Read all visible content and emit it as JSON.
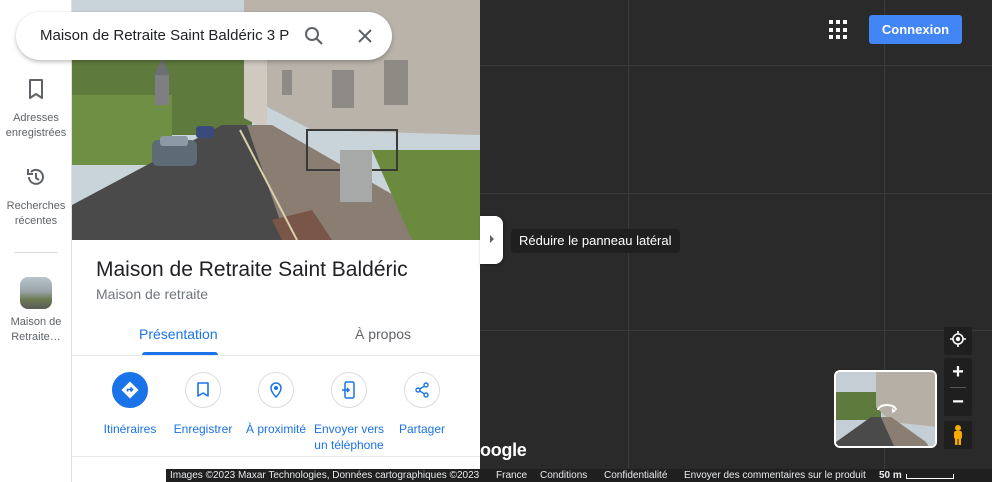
{
  "search": {
    "query": "Maison de Retraite Saint Baldéric 3 P",
    "search_icon": "search-icon",
    "close_icon": "close-icon"
  },
  "rail": {
    "saved": {
      "label": "Adresses enregistrées",
      "icon": "bookmark-icon"
    },
    "recent": {
      "label": "Recherches récentes",
      "icon": "history-icon"
    },
    "place": {
      "label": "Maison de Retraite…"
    }
  },
  "place": {
    "name": "Maison de Retraite Saint Baldéric",
    "category": "Maison de retraite"
  },
  "tabs": [
    {
      "label": "Présentation",
      "active": true
    },
    {
      "label": "À propos",
      "active": false
    }
  ],
  "actions": [
    {
      "label": "Itinéraires",
      "icon": "directions-icon"
    },
    {
      "label": "Enregistrer",
      "icon": "bookmark-icon"
    },
    {
      "label": "À proximité",
      "icon": "nearby-icon"
    },
    {
      "label": "Envoyer vers un téléphone",
      "icon": "send-to-phone-icon"
    },
    {
      "label": "Partager",
      "icon": "share-icon"
    }
  ],
  "collapse": {
    "tooltip": "Réduire le panneau latéral"
  },
  "header": {
    "signin_label": "Connexion",
    "apps_icon": "apps-grid-icon"
  },
  "map": {
    "logo_text": "oogle",
    "attribution": "Images ©2023 Maxar Technologies, Données cartographiques ©2023",
    "links": [
      "France",
      "Conditions",
      "Confidentialité",
      "Envoyer des commentaires sur le produit"
    ],
    "scale": "50 m"
  },
  "colors": {
    "accent": "#1a73e8",
    "signin": "#4285f4",
    "map_bg": "#2a2a2a"
  }
}
